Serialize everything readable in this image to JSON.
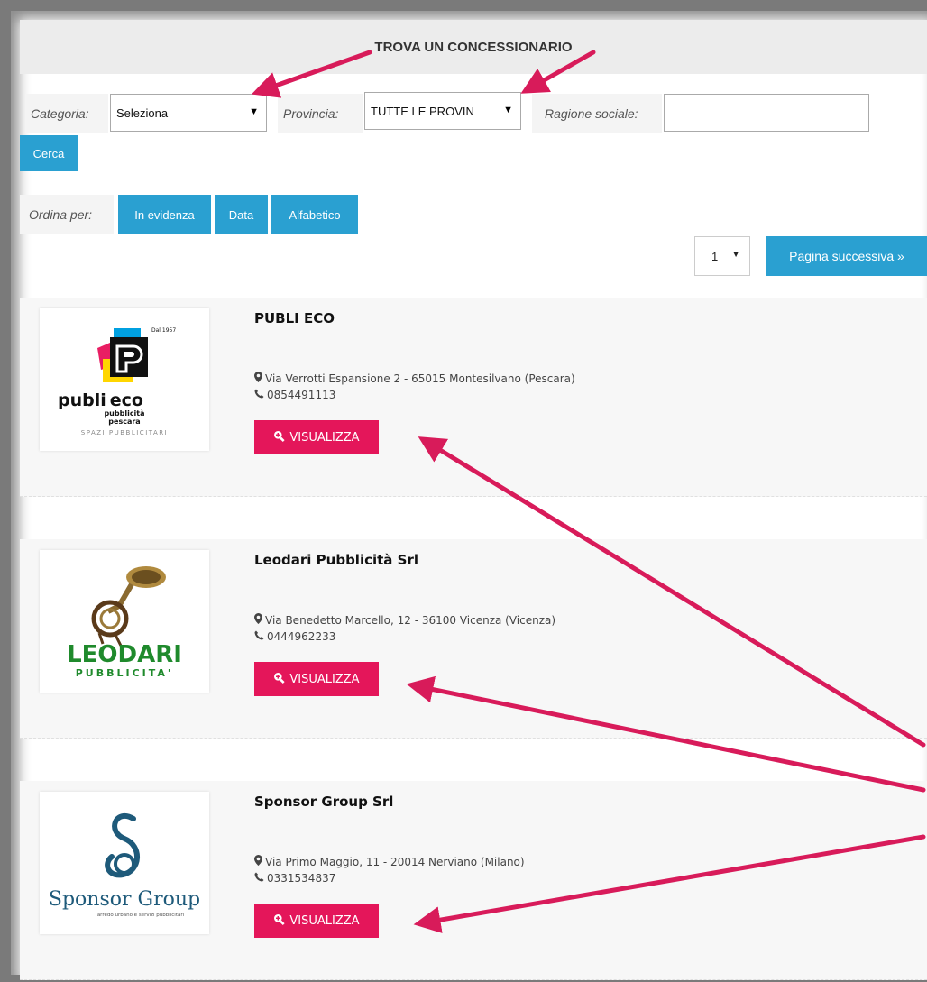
{
  "header": {
    "title": "TROVA UN CONCESSIONARIO"
  },
  "filters": {
    "categoria_label": "Categoria:",
    "categoria_value": "Seleziona",
    "provincia_label": "Provincia:",
    "provincia_value": "TUTTE LE PROVIN",
    "ragione_label": "Ragione sociale:",
    "ragione_value": "",
    "search_button": "Cerca"
  },
  "sort": {
    "label": "Ordina per:",
    "options": [
      "In evidenza",
      "Data",
      "Alfabetico"
    ]
  },
  "pagination": {
    "page": "1",
    "next_label": "Pagina successiva »"
  },
  "listings": [
    {
      "name": "PUBLI ECO",
      "address": "Via Verrotti Espansione 2 - 65015 Montesilvano (Pescara)",
      "phone": "0854491113",
      "button": "VISUALIZZA",
      "logo": {
        "year": "Dal 1957",
        "brand_a": "publi",
        "brand_b": "eco",
        "line1": "pubblicità",
        "line2": "pescara",
        "tagline": "SPAZI PUBBLICITARI"
      }
    },
    {
      "name": "Leodari Pubblicità Srl",
      "address": "Via Benedetto Marcello, 12 - 36100 Vicenza (Vicenza)",
      "phone": "0444962233",
      "button": "VISUALIZZA",
      "logo": {
        "brand": "LEODARI",
        "sub": "PUBBLICITA'"
      }
    },
    {
      "name": "Sponsor Group Srl",
      "address": "Via Primo Maggio, 11 - 20014 Nerviano (Milano)",
      "phone": "0331534837",
      "button": "VISUALIZZA",
      "logo": {
        "brand": "Sponsor Group",
        "tagline": "arredo urbano e servizi pubblicitari"
      }
    }
  ],
  "colors": {
    "accent_blue": "#2aa0d1",
    "view_button": "#e4165a",
    "annotation_arrow": "#d81b5a"
  },
  "icons": {
    "map_marker": "map-marker-icon",
    "phone": "phone-icon",
    "zoom": "zoom-icon",
    "dropdown": "caret-down-icon"
  }
}
